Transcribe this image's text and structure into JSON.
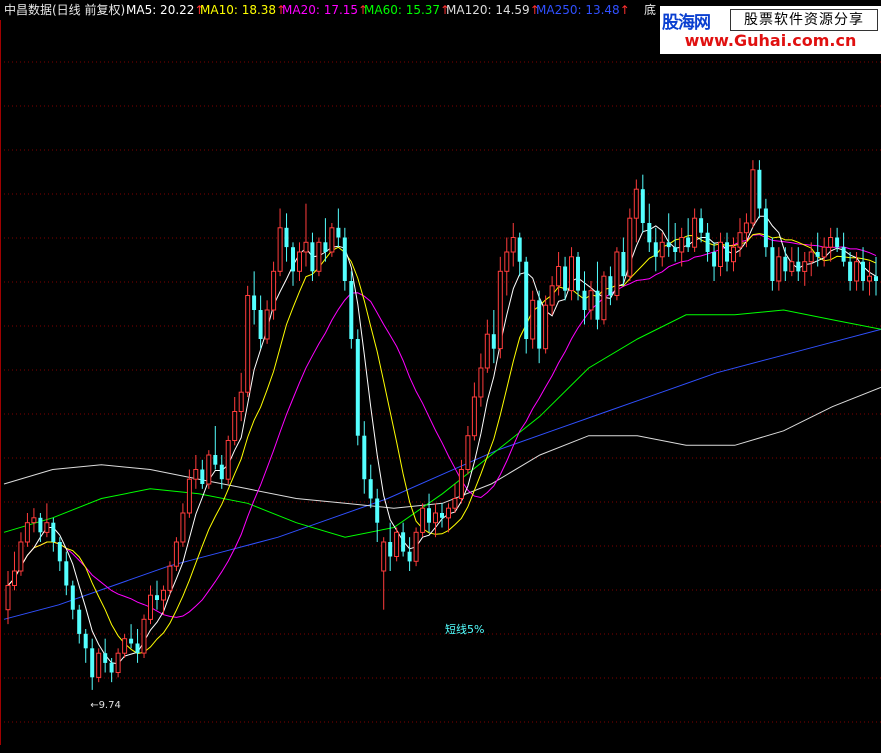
{
  "header": {
    "title": "中昌数据(日线 前复权)",
    "ma_items": [
      {
        "label": "MA5: 20.22",
        "color": "#ffffff"
      },
      {
        "label": "MA10: 18.38",
        "color": "#ffff00"
      },
      {
        "label": "MA20: 17.15",
        "color": "#ff00ff"
      },
      {
        "label": "MA60: 15.37",
        "color": "#00ff00"
      },
      {
        "label": "MA120: 14.59",
        "color": "#dcdcdc"
      },
      {
        "label": "MA250: 13.48",
        "color": "#3050ff"
      }
    ],
    "right_label": "底"
  },
  "watermark": {
    "logo": "股海网",
    "slogan": "股票软件资源分享",
    "url": "www.Guhai.com.cn"
  },
  "chart_data": {
    "type": "candlestick",
    "y_range": [
      8.6,
      23.6
    ],
    "annotations": {
      "low_label": "←9.74",
      "signal_label": "短线5%"
    },
    "candles": [
      [
        11.4,
        12.2,
        11.1,
        11.9
      ],
      [
        11.9,
        12.6,
        11.8,
        12.2
      ],
      [
        12.2,
        13.0,
        12.1,
        12.8
      ],
      [
        12.8,
        13.4,
        12.7,
        13.2
      ],
      [
        13.2,
        13.5,
        13.0,
        13.3
      ],
      [
        13.3,
        13.4,
        12.8,
        13.0
      ],
      [
        13.0,
        13.6,
        12.9,
        13.2
      ],
      [
        13.2,
        13.3,
        12.6,
        12.8
      ],
      [
        12.8,
        12.9,
        12.2,
        12.4
      ],
      [
        12.4,
        12.6,
        11.7,
        11.9
      ],
      [
        11.9,
        12.0,
        11.2,
        11.4
      ],
      [
        11.4,
        11.5,
        10.7,
        10.9
      ],
      [
        10.9,
        11.0,
        10.3,
        10.6
      ],
      [
        10.6,
        10.8,
        9.74,
        10.0
      ],
      [
        10.0,
        10.6,
        9.9,
        10.5
      ],
      [
        10.5,
        10.8,
        10.1,
        10.3
      ],
      [
        10.3,
        10.4,
        9.9,
        10.1
      ],
      [
        10.1,
        10.6,
        10.0,
        10.5
      ],
      [
        10.5,
        10.9,
        10.4,
        10.8
      ],
      [
        10.8,
        11.1,
        10.6,
        10.7
      ],
      [
        10.7,
        11.0,
        10.3,
        10.5
      ],
      [
        10.5,
        11.3,
        10.4,
        11.2
      ],
      [
        11.2,
        11.9,
        11.1,
        11.7
      ],
      [
        11.7,
        12.0,
        11.4,
        11.6
      ],
      [
        11.6,
        11.9,
        11.3,
        11.8
      ],
      [
        11.8,
        12.4,
        11.7,
        12.3
      ],
      [
        12.3,
        12.9,
        12.2,
        12.8
      ],
      [
        12.8,
        13.6,
        12.7,
        13.4
      ],
      [
        13.4,
        14.3,
        13.3,
        14.1
      ],
      [
        14.1,
        14.6,
        13.9,
        14.3
      ],
      [
        14.3,
        14.5,
        13.9,
        14.0
      ],
      [
        14.0,
        14.7,
        13.9,
        14.6
      ],
      [
        14.6,
        15.2,
        14.3,
        14.4
      ],
      [
        14.4,
        14.6,
        13.9,
        14.1
      ],
      [
        14.1,
        15.0,
        14.0,
        14.9
      ],
      [
        14.9,
        15.8,
        14.8,
        15.5
      ],
      [
        15.5,
        16.3,
        15.3,
        15.9
      ],
      [
        15.9,
        18.1,
        15.8,
        17.9
      ],
      [
        17.9,
        18.4,
        17.3,
        17.6
      ],
      [
        17.6,
        17.9,
        16.8,
        17.0
      ],
      [
        17.0,
        17.8,
        16.9,
        17.6
      ],
      [
        17.6,
        18.6,
        17.4,
        18.4
      ],
      [
        18.4,
        19.7,
        18.3,
        19.3
      ],
      [
        19.3,
        19.6,
        18.6,
        18.9
      ],
      [
        18.9,
        19.0,
        18.1,
        18.4
      ],
      [
        18.4,
        19.0,
        18.2,
        18.8
      ],
      [
        18.8,
        19.8,
        18.5,
        19.0
      ],
      [
        19.0,
        19.2,
        18.2,
        18.4
      ],
      [
        18.4,
        19.1,
        18.3,
        19.0
      ],
      [
        19.0,
        19.5,
        18.6,
        18.8
      ],
      [
        18.8,
        19.4,
        18.7,
        19.3
      ],
      [
        19.3,
        19.7,
        18.9,
        19.1
      ],
      [
        19.1,
        19.3,
        18.0,
        18.2
      ],
      [
        18.2,
        18.4,
        16.8,
        17.0
      ],
      [
        17.0,
        17.2,
        14.8,
        15.0
      ],
      [
        15.0,
        15.3,
        13.8,
        14.1
      ],
      [
        14.1,
        14.4,
        13.5,
        13.7
      ],
      [
        13.7,
        13.9,
        12.8,
        13.2
      ],
      [
        12.2,
        12.9,
        11.4,
        12.8
      ],
      [
        12.8,
        13.2,
        12.2,
        12.5
      ],
      [
        12.5,
        13.1,
        12.4,
        13.0
      ],
      [
        13.0,
        13.2,
        12.5,
        12.6
      ],
      [
        12.6,
        12.9,
        12.2,
        12.4
      ],
      [
        12.4,
        13.1,
        12.3,
        13.0
      ],
      [
        13.0,
        13.6,
        12.9,
        13.5
      ],
      [
        13.5,
        13.8,
        13.0,
        13.2
      ],
      [
        13.2,
        13.6,
        12.9,
        13.4
      ],
      [
        13.4,
        13.6,
        13.1,
        13.3
      ],
      [
        13.3,
        13.6,
        13.0,
        13.5
      ],
      [
        13.5,
        14.0,
        13.4,
        13.7
      ],
      [
        13.7,
        14.5,
        13.6,
        14.3
      ],
      [
        14.3,
        15.2,
        14.2,
        15.0
      ],
      [
        15.0,
        16.1,
        14.9,
        15.8
      ],
      [
        15.8,
        16.7,
        15.6,
        16.4
      ],
      [
        16.4,
        17.4,
        16.3,
        17.1
      ],
      [
        17.1,
        17.6,
        16.5,
        16.8
      ],
      [
        16.8,
        18.7,
        16.6,
        18.4
      ],
      [
        18.4,
        19.1,
        17.9,
        18.8
      ],
      [
        18.8,
        19.4,
        18.5,
        19.1
      ],
      [
        19.1,
        19.2,
        18.3,
        18.6
      ],
      [
        18.6,
        18.7,
        16.7,
        17.0
      ],
      [
        17.0,
        18.0,
        16.8,
        17.8
      ],
      [
        17.8,
        18.0,
        16.5,
        16.8
      ],
      [
        16.8,
        17.9,
        16.7,
        17.7
      ],
      [
        17.7,
        18.3,
        17.5,
        18.1
      ],
      [
        18.1,
        18.8,
        17.9,
        18.5
      ],
      [
        18.5,
        18.7,
        17.8,
        18.0
      ],
      [
        18.0,
        18.9,
        17.8,
        18.7
      ],
      [
        18.7,
        18.8,
        17.8,
        18.0
      ],
      [
        18.0,
        18.4,
        17.3,
        17.6
      ],
      [
        17.6,
        18.2,
        17.4,
        18.0
      ],
      [
        18.0,
        18.6,
        17.2,
        17.4
      ],
      [
        17.4,
        18.4,
        17.3,
        18.3
      ],
      [
        18.3,
        18.5,
        17.7,
        17.9
      ],
      [
        17.9,
        18.9,
        17.8,
        18.8
      ],
      [
        18.8,
        19.1,
        18.1,
        18.3
      ],
      [
        18.3,
        19.7,
        18.2,
        19.5
      ],
      [
        19.5,
        20.3,
        19.0,
        20.1
      ],
      [
        20.1,
        20.4,
        19.2,
        19.4
      ],
      [
        19.4,
        19.8,
        18.8,
        19.0
      ],
      [
        19.0,
        19.3,
        18.4,
        18.7
      ],
      [
        18.7,
        19.2,
        18.5,
        19.0
      ],
      [
        19.0,
        19.6,
        18.7,
        18.9
      ],
      [
        18.9,
        19.4,
        18.6,
        18.8
      ],
      [
        18.8,
        19.3,
        18.5,
        19.1
      ],
      [
        19.1,
        19.5,
        18.8,
        18.9
      ],
      [
        18.9,
        19.7,
        18.8,
        19.5
      ],
      [
        19.5,
        19.7,
        19.0,
        19.2
      ],
      [
        19.2,
        19.4,
        18.6,
        18.8
      ],
      [
        18.8,
        19.0,
        18.2,
        18.5
      ],
      [
        18.5,
        19.2,
        18.3,
        19.0
      ],
      [
        19.0,
        19.2,
        18.4,
        18.6
      ],
      [
        18.6,
        19.1,
        18.4,
        18.9
      ],
      [
        18.9,
        19.5,
        18.7,
        19.2
      ],
      [
        19.2,
        19.6,
        18.9,
        19.4
      ],
      [
        19.4,
        20.7,
        19.3,
        20.5
      ],
      [
        20.5,
        20.7,
        19.5,
        19.7
      ],
      [
        19.7,
        19.9,
        18.7,
        18.9
      ],
      [
        18.9,
        19.1,
        18.0,
        18.2
      ],
      [
        18.2,
        18.9,
        18.0,
        18.7
      ],
      [
        18.7,
        18.9,
        18.2,
        18.4
      ],
      [
        18.4,
        18.9,
        18.3,
        18.6
      ],
      [
        18.6,
        18.9,
        18.2,
        18.4
      ],
      [
        18.4,
        18.8,
        18.1,
        18.6
      ],
      [
        18.6,
        19.0,
        18.3,
        18.8
      ],
      [
        18.8,
        19.2,
        18.5,
        18.7
      ],
      [
        18.7,
        19.1,
        18.5,
        18.9
      ],
      [
        18.9,
        19.3,
        18.6,
        19.1
      ],
      [
        19.1,
        19.3,
        18.8,
        18.9
      ],
      [
        18.9,
        19.2,
        18.5,
        18.6
      ],
      [
        18.6,
        18.8,
        18.0,
        18.2
      ],
      [
        18.2,
        18.8,
        18.0,
        18.6
      ],
      [
        18.6,
        18.9,
        18.0,
        18.2
      ],
      [
        18.2,
        18.6,
        17.9,
        18.3
      ],
      [
        18.3,
        18.7,
        17.9,
        18.2
      ]
    ],
    "ma_colors": {
      "5": "#ffffff",
      "10": "#ffff00",
      "20": "#ff00ff",
      "60": "#00ff00",
      "120": "#dcdcdc",
      "250": "#3050ff"
    },
    "ma60_points": [
      13.0,
      13.3,
      13.7,
      13.9,
      13.8,
      13.6,
      13.2,
      12.9,
      13.1,
      13.8,
      14.6,
      15.4,
      16.4,
      17.0,
      17.5,
      17.5,
      17.6,
      17.4,
      17.2
    ],
    "ma120_points": [
      14.0,
      14.3,
      14.4,
      14.3,
      14.1,
      13.9,
      13.7,
      13.6,
      13.5,
      13.6,
      14.0,
      14.6,
      15.0,
      15.0,
      14.8,
      14.8,
      15.1,
      15.6,
      16.0
    ],
    "ma250_points": [
      11.2,
      11.5,
      11.9,
      12.3,
      12.6,
      12.9,
      13.3,
      13.7,
      14.2,
      14.7,
      15.1,
      15.5,
      15.9,
      16.3,
      16.6,
      16.9,
      17.2
    ]
  }
}
